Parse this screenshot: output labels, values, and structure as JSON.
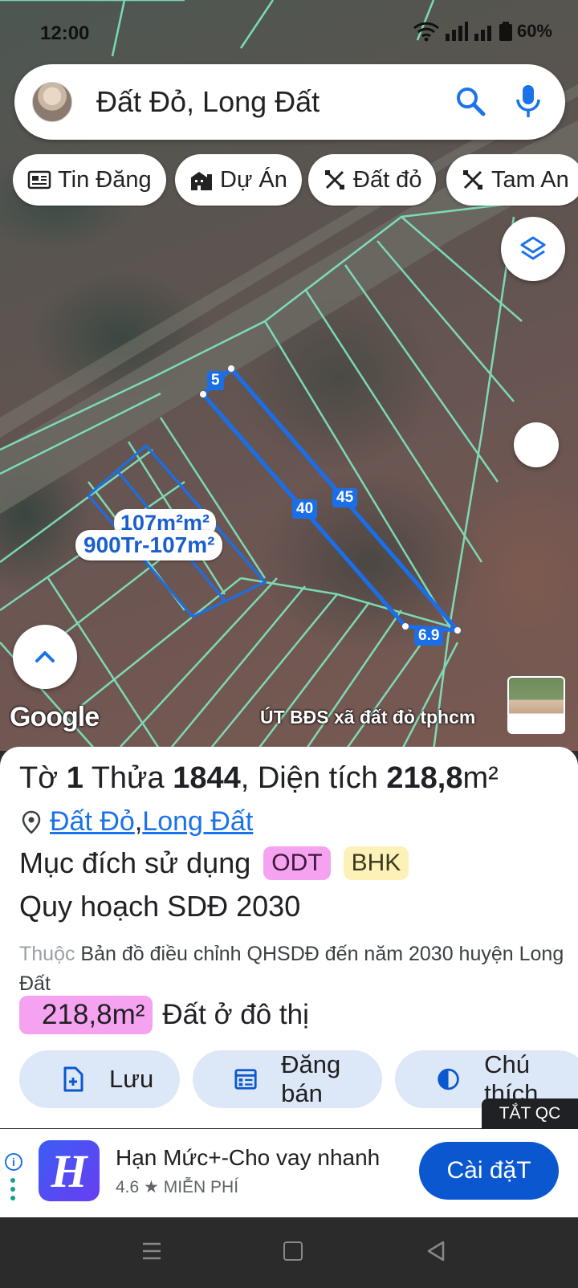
{
  "status_bar": {
    "time": "12:00",
    "battery": "60%"
  },
  "search": {
    "text": "Đất Đỏ, Long Đất"
  },
  "chips": [
    {
      "label": "Tin Đăng",
      "icon": "newspaper-icon"
    },
    {
      "label": "Dự Án",
      "icon": "building-icon"
    },
    {
      "label": "Đất đỏ",
      "icon": "ruler-pencil-icon"
    },
    {
      "label": "Tam An",
      "icon": "ruler-pencil-icon"
    }
  ],
  "map": {
    "parcel_edges": {
      "top": "5",
      "right": "45",
      "left": "40",
      "bottom": "6.9"
    },
    "listing_label_back": "107m²m²",
    "listing_label": "900Tr-107m²",
    "google_logo": "Google",
    "credit": "ÚT BĐS xã đất đỏ tphcm"
  },
  "sheet": {
    "title_prefix": "Tờ ",
    "sheet_no": "1",
    "title_mid": " Thửa ",
    "parcel_no": "1844",
    "title_area_label": ", Diện tích ",
    "area_value": "218,8",
    "area_unit": "m²",
    "location_district": "Đất Đỏ",
    "location_sep": ", ",
    "location_region": "Long Đất",
    "purpose_label": "Mục đích sử dụng",
    "purpose_badges": [
      "ODT",
      "BHK"
    ],
    "plan_title": "Quy hoạch SDĐ 2030",
    "plan_desc_prefix": "Thuộc",
    "plan_desc": " Bản đồ điều chỉnh QHSDĐ đến năm 2030 huyện Long Đất",
    "area_badge": "218,8m²",
    "area_type": "Đất ở đô thị",
    "actions": [
      {
        "label": "Lưu",
        "icon": "file-add-icon"
      },
      {
        "label": "Đăng bán",
        "icon": "calendar-list-icon"
      },
      {
        "label": "Chú thích",
        "icon": "half-circle-icon"
      }
    ],
    "ads_off": "TẮT QC"
  },
  "ad": {
    "app_letter": "H",
    "title": "Hạn Mức+-Cho vay nhanh",
    "rating": "4.6",
    "price": "MIỄN PHÍ",
    "install": "Cài đặT"
  },
  "colors": {
    "parcel_outline": "#7fe8c0",
    "highlight": "#1a6fe8",
    "accent": "#0b57d0",
    "odt": "#f5a3f0",
    "bhk": "#fdf1b8"
  }
}
